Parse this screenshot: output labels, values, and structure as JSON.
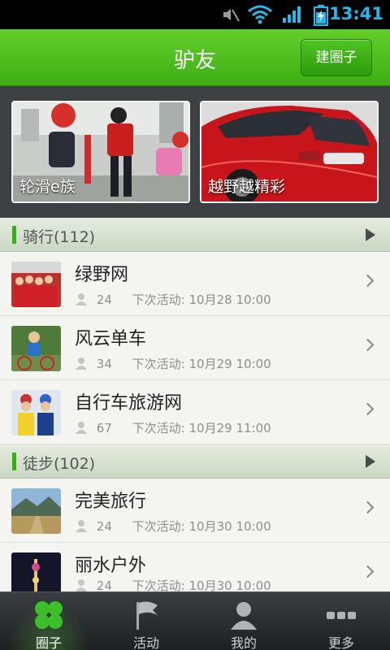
{
  "status_bar": {
    "time": "13:41"
  },
  "header": {
    "title": "驴友",
    "create_button": "建圈子"
  },
  "banners": [
    {
      "caption": "轮滑e族"
    },
    {
      "caption": "越野越精彩"
    }
  ],
  "sections": [
    {
      "label": "骑行(112)",
      "items": [
        {
          "name": "绿野网",
          "members": "24",
          "next_label": "下次活动:",
          "next_time": "10月28 10:00"
        },
        {
          "name": "风云单车",
          "members": "34",
          "next_label": "下次活动:",
          "next_time": "10月29 10:00"
        },
        {
          "name": "自行车旅游网",
          "members": "67",
          "next_label": "下次活动:",
          "next_time": "10月29 11:00"
        }
      ]
    },
    {
      "label": "徒步(102)",
      "items": [
        {
          "name": "完美旅行",
          "members": "24",
          "next_label": "下次活动:",
          "next_time": "10月30 10:00"
        },
        {
          "name": "丽水户外",
          "members": "24",
          "next_label": "下次活动:",
          "next_time": "10月30 10:00"
        }
      ]
    }
  ],
  "tabs": [
    {
      "label": "圈子",
      "icon": "clover-icon",
      "active": true
    },
    {
      "label": "活动",
      "icon": "flag-icon",
      "active": false
    },
    {
      "label": "我的",
      "icon": "person-icon",
      "active": false
    },
    {
      "label": "更多",
      "icon": "more-dots-icon",
      "active": false
    }
  ]
}
